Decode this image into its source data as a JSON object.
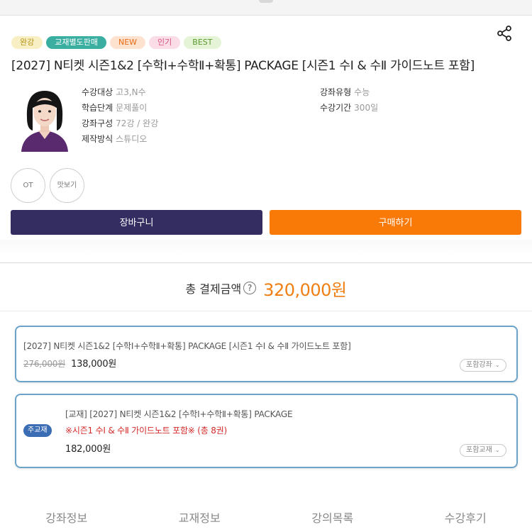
{
  "badges": {
    "full": "완강",
    "book_sold_separately": "교재별도판매",
    "new": "NEW",
    "popular": "인기",
    "best": "BEST"
  },
  "course": {
    "title": "[2027] N티켓 시즌1&2 [수학Ⅰ+수학Ⅱ+확통] PACKAGE [시즌1 수Ⅰ & 수Ⅱ 가이드노트 포함]"
  },
  "info_left": [
    {
      "label": "수강대상",
      "value": "고3,N수"
    },
    {
      "label": "학습단계",
      "value": "문제풀이"
    },
    {
      "label": "강좌구성",
      "value": "72강 / 완강"
    },
    {
      "label": "제작방식",
      "value": "스튜디오"
    }
  ],
  "info_right": [
    {
      "label": "강좌유형",
      "value": "수능"
    },
    {
      "label": "수강기간",
      "value": "300일"
    }
  ],
  "circles": {
    "ot": "OT",
    "preview": "맛보기"
  },
  "buttons": {
    "cart": "장바구니",
    "buy": "구매하기"
  },
  "total": {
    "label": "총 결제금액",
    "help": "?",
    "amount": "320,000원"
  },
  "lecture_item": {
    "title": "[2027] N티켓 시즌1&2 [수학Ⅰ+수학Ⅱ+확통] PACKAGE [시즌1 수Ⅰ & 수Ⅱ 가이드노트 포함]",
    "original_price": "276,000원",
    "price": "138,000원",
    "included_label": "포함강좌"
  },
  "textbook_item": {
    "badge": "주교재",
    "title": "[교재] [2027] N티켓 시즌1&2 [수학Ⅰ+수학Ⅱ+확통] PACKAGE",
    "note": "※시즌1 수Ⅰ & 수Ⅱ 가이드노트 포함※ (총 8권)",
    "price": "182,000원",
    "included_label": "포함교재"
  },
  "tabs": [
    "강좌정보",
    "교재정보",
    "강의목록",
    "수강후기"
  ],
  "colors": {
    "cart_button": "#332d62",
    "buy_button": "#fa7a08",
    "total_amount": "#f07f13",
    "card_border": "#6ba3c9",
    "main_badge": "#3b6db5",
    "note_red": "#d42a2a"
  },
  "icons": {
    "share": "share-icon",
    "chevron": "chevron-down-icon"
  }
}
